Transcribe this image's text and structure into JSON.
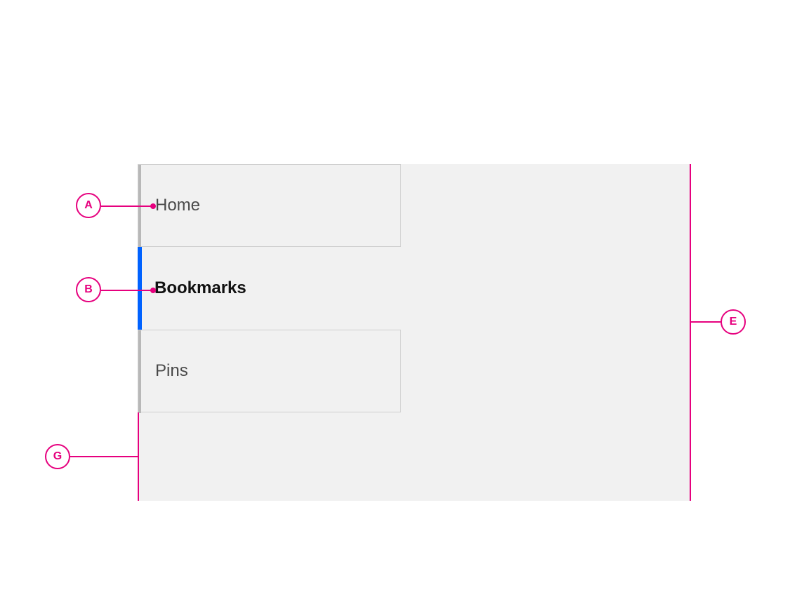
{
  "tabs": {
    "home": {
      "label": "Home"
    },
    "bookmarks": {
      "label": "Bookmarks"
    },
    "pins": {
      "label": "Pins"
    }
  },
  "callouts": {
    "A": "A",
    "B": "B",
    "E": "E",
    "G": "G"
  },
  "colors": {
    "accent": "#0062ff",
    "annotation": "#e6007e",
    "muted": "#b8b8b8",
    "panel": "#f1f1f1"
  }
}
